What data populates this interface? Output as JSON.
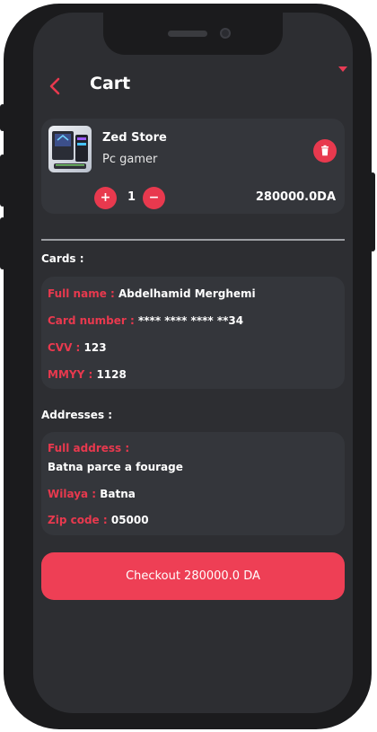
{
  "header": {
    "title": "Cart"
  },
  "cart_item": {
    "store": "Zed Store",
    "product": "Pc gamer",
    "quantity": "1",
    "plus_label": "+",
    "minus_label": "−",
    "price": "280000.0DA",
    "thumbnail_icon": "gaming-pc-image",
    "delete_icon": "trash-icon"
  },
  "cards_section": {
    "title": "Cards :",
    "full_name_label": "Full name :",
    "full_name": "Abdelhamid Merghemi",
    "card_number_label": "Card number :",
    "card_number": "**** **** **** **34",
    "cvv_label": "CVV :",
    "cvv": "123",
    "mmyy_label": "MMYY :",
    "mmyy": "1128"
  },
  "addresses_section": {
    "title": "Addresses :",
    "full_address_label": "Full address :",
    "full_address": "Batna parce a fourage",
    "wilaya_label": "Wilaya :",
    "wilaya": "Batna",
    "zip_label": "Zip code :",
    "zip": "05000"
  },
  "checkout": {
    "label": "Checkout 280000.0 DA"
  },
  "colors": {
    "accent": "#e8394e",
    "background": "#2d2e32",
    "card": "#34363b",
    "frame": "#1b1b1d"
  }
}
